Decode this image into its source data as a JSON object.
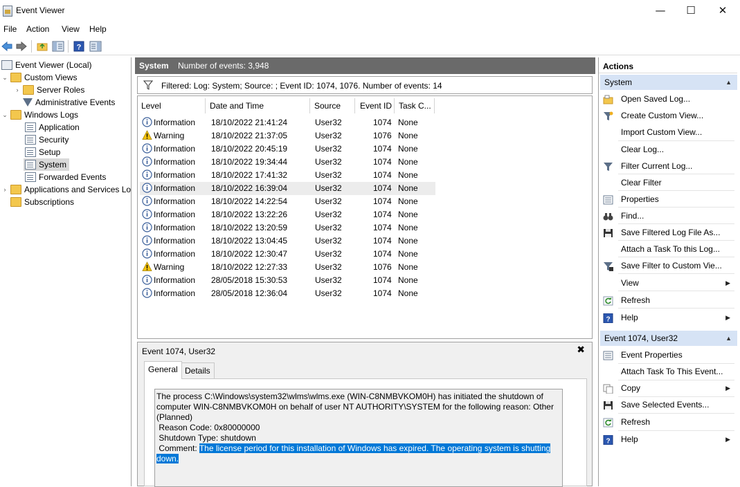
{
  "window": {
    "title": "Event Viewer"
  },
  "menu": [
    "File",
    "Action",
    "View",
    "Help"
  ],
  "tree": {
    "root": "Event Viewer (Local)",
    "custom_views": "Custom Views",
    "server_roles": "Server Roles",
    "administrative_events": "Administrative Events",
    "windows_logs": "Windows Logs",
    "application": "Application",
    "security": "Security",
    "setup": "Setup",
    "system": "System",
    "forwarded_events": "Forwarded Events",
    "apps_services": "Applications and Services Lo",
    "subscriptions": "Subscriptions"
  },
  "center": {
    "log_name": "System",
    "event_count": "Number of events: 3,948",
    "filter_text": "Filtered: Log: System; Source: ; Event ID: 1074, 1076. Number of events: 14",
    "columns": [
      "Level",
      "Date and Time",
      "Source",
      "Event ID",
      "Task C..."
    ],
    "rows": [
      {
        "level": "Information",
        "date": "18/10/2022 21:41:24",
        "source": "User32",
        "id": "1074",
        "task": "None"
      },
      {
        "level": "Warning",
        "date": "18/10/2022 21:37:05",
        "source": "User32",
        "id": "1076",
        "task": "None"
      },
      {
        "level": "Information",
        "date": "18/10/2022 20:45:19",
        "source": "User32",
        "id": "1074",
        "task": "None"
      },
      {
        "level": "Information",
        "date": "18/10/2022 19:34:44",
        "source": "User32",
        "id": "1074",
        "task": "None"
      },
      {
        "level": "Information",
        "date": "18/10/2022 17:41:32",
        "source": "User32",
        "id": "1074",
        "task": "None"
      },
      {
        "level": "Information",
        "date": "18/10/2022 16:39:04",
        "source": "User32",
        "id": "1074",
        "task": "None"
      },
      {
        "level": "Information",
        "date": "18/10/2022 14:22:54",
        "source": "User32",
        "id": "1074",
        "task": "None"
      },
      {
        "level": "Information",
        "date": "18/10/2022 13:22:26",
        "source": "User32",
        "id": "1074",
        "task": "None"
      },
      {
        "level": "Information",
        "date": "18/10/2022 13:20:59",
        "source": "User32",
        "id": "1074",
        "task": "None"
      },
      {
        "level": "Information",
        "date": "18/10/2022 13:04:45",
        "source": "User32",
        "id": "1074",
        "task": "None"
      },
      {
        "level": "Information",
        "date": "18/10/2022 12:30:47",
        "source": "User32",
        "id": "1074",
        "task": "None"
      },
      {
        "level": "Warning",
        "date": "18/10/2022 12:27:33",
        "source": "User32",
        "id": "1076",
        "task": "None"
      },
      {
        "level": "Information",
        "date": "28/05/2018 15:30:53",
        "source": "User32",
        "id": "1074",
        "task": "None"
      },
      {
        "level": "Information",
        "date": "28/05/2018 12:36:04",
        "source": "User32",
        "id": "1074",
        "task": "None"
      }
    ]
  },
  "detail": {
    "title": "Event 1074, User32",
    "tabs": [
      "General",
      "Details"
    ],
    "line1": "The process C:\\Windows\\system32\\wlms\\wlms.exe (WIN-C8NMBVKOM0H) has initiated the shutdown of",
    "line2": "computer WIN-C8NMBVKOM0H on behalf of user NT AUTHORITY\\SYSTEM for the following reason: Other",
    "line3": "(Planned)",
    "line4": " Reason Code: 0x80000000",
    "line5": " Shutdown Type: shutdown",
    "comment_label": " Comment: ",
    "comment_text_1": "The license period for this installation of Windows has expired. The operating system is shutting",
    "comment_text_2": "down."
  },
  "actions": {
    "header": "Actions",
    "section1": "System",
    "items1": [
      "Open Saved Log...",
      "Create Custom View...",
      "Import Custom View...",
      "Clear Log...",
      "Filter Current Log...",
      "Clear Filter",
      "Properties",
      "Find...",
      "Save Filtered Log File As...",
      "Attach a Task To this Log...",
      "Save Filter to Custom Vie...",
      "View",
      "Refresh",
      "Help"
    ],
    "section2": "Event 1074, User32",
    "items2": [
      "Event Properties",
      "Attach Task To This Event...",
      "Copy",
      "Save Selected Events...",
      "Refresh",
      "Help"
    ]
  }
}
